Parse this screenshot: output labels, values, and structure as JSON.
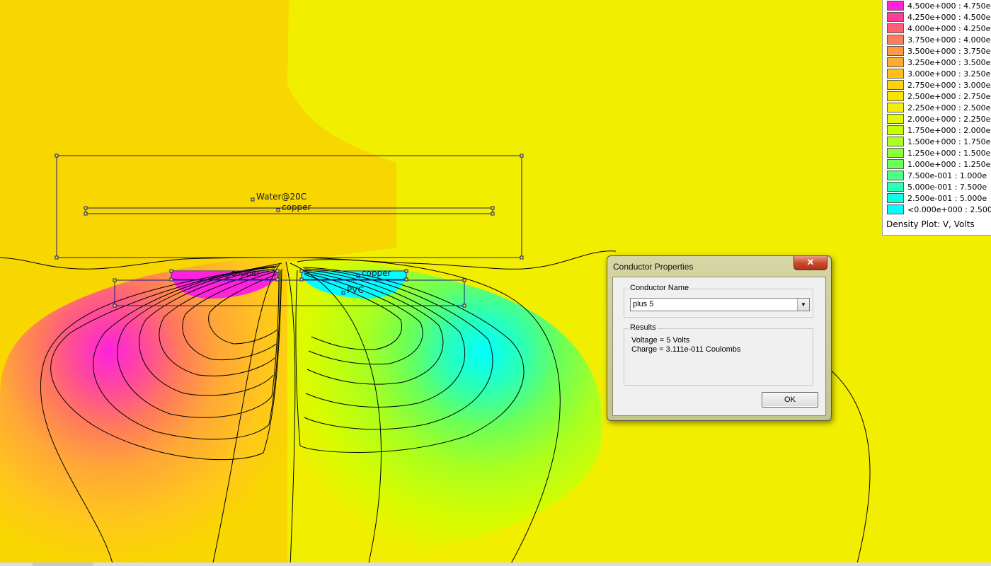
{
  "plot": {
    "labels": {
      "water": "Water@20C",
      "copper_top": "copper",
      "copper_left": "copper",
      "copper_right": "copper",
      "pvc": "PVC"
    },
    "colors": {
      "background": "#f2ee00",
      "left_field": "#f8d600",
      "negative_region": "#00ffff",
      "positive_region": "#ff22dd",
      "contour": "#000000"
    }
  },
  "legend": {
    "rows": [
      {
        "color": "#ff22dd",
        "label": "4.500e+000 : 4.750e"
      },
      {
        "color": "#ff3e9c",
        "label": "4.250e+000 : 4.500e"
      },
      {
        "color": "#ff5f76",
        "label": "4.000e+000 : 4.250e"
      },
      {
        "color": "#ff7c58",
        "label": "3.750e+000 : 4.000e"
      },
      {
        "color": "#ff9842",
        "label": "3.500e+000 : 3.750e"
      },
      {
        "color": "#ffac2e",
        "label": "3.250e+000 : 3.500e"
      },
      {
        "color": "#ffc01c",
        "label": "3.000e+000 : 3.250e"
      },
      {
        "color": "#ffd40c",
        "label": "2.750e+000 : 3.000e"
      },
      {
        "color": "#fbe400",
        "label": "2.500e+000 : 2.750e"
      },
      {
        "color": "#f4f000",
        "label": "2.250e+000 : 2.500e"
      },
      {
        "color": "#e2fa00",
        "label": "2.000e+000 : 2.250e"
      },
      {
        "color": "#c8ff00",
        "label": "1.750e+000 : 2.000e"
      },
      {
        "color": "#aaff1e",
        "label": "1.500e+000 : 1.750e"
      },
      {
        "color": "#8cff3a",
        "label": "1.250e+000 : 1.500e"
      },
      {
        "color": "#6cff58",
        "label": "1.000e+000 : 1.250e"
      },
      {
        "color": "#4cff86",
        "label": "7.500e-001 : 1.000e"
      },
      {
        "color": "#2cffb4",
        "label": "5.000e-001 : 7.500e"
      },
      {
        "color": "#10ffe0",
        "label": "2.500e-001 : 5.000e"
      },
      {
        "color": "#00ffff",
        "label": "<0.000e+000 : 2.500"
      }
    ],
    "caption": "Density Plot: V, Volts"
  },
  "dialog": {
    "title": "Conductor Properties",
    "close_glyph": "✕",
    "conductor_group_label": "Conductor Name",
    "conductor_name": "plus 5",
    "dropdown_icon": "chevron-down-icon",
    "results_group_label": "Results",
    "voltage_text": "Voltage = 5 Volts",
    "charge_text": "Charge = 3.111e-011 Coulombs",
    "ok_label": "OK"
  }
}
